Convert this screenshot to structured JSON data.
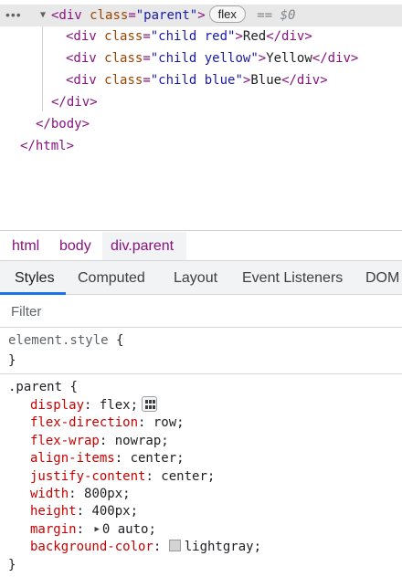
{
  "dom_tree": {
    "ellipsis": "•••",
    "selected": {
      "expand_arrow": "▼",
      "tag_open": "<div",
      "attr_name": "class",
      "attr_value": "\"parent\"",
      "tag_close": ">",
      "badge": "flex",
      "eq_marker": "== $0"
    },
    "children": [
      {
        "tag_open": "<div",
        "attr_name": "class",
        "attr_value": "\"child red\"",
        "tag_close": ">",
        "text": "Red",
        "end_tag": "</div>"
      },
      {
        "tag_open": "<div",
        "attr_name": "class",
        "attr_value": "\"child yellow\"",
        "tag_close": ">",
        "text": "Yellow",
        "end_tag": "</div>"
      },
      {
        "tag_open": "<div",
        "attr_name": "class",
        "attr_value": "\"child blue\"",
        "tag_close": ">",
        "text": "Blue",
        "end_tag": "</div>"
      }
    ],
    "closing": [
      "</div>",
      "</body>",
      "</html>"
    ]
  },
  "breadcrumb": [
    "html",
    "body",
    "div.parent"
  ],
  "tabs": [
    "Styles",
    "Computed",
    "Layout",
    "Event Listeners",
    "DOM"
  ],
  "active_tab": "Styles",
  "filter": {
    "placeholder": "Filter"
  },
  "styles": {
    "element_style": {
      "selector": "element.style",
      "open": "{",
      "close": "}"
    },
    "parent_rule": {
      "selector": ".parent",
      "open": "{",
      "close": "}",
      "declarations": [
        {
          "prop": "display",
          "value": "flex",
          "extra": "flex-editor-icon"
        },
        {
          "prop": "flex-direction",
          "value": "row"
        },
        {
          "prop": "flex-wrap",
          "value": "nowrap"
        },
        {
          "prop": "align-items",
          "value": "center"
        },
        {
          "prop": "justify-content",
          "value": "center"
        },
        {
          "prop": "width",
          "value": "800px"
        },
        {
          "prop": "height",
          "value": "400px"
        },
        {
          "prop": "margin",
          "value": "0 auto",
          "extra": "expand-arrow"
        },
        {
          "prop": "background-color",
          "value": "lightgray",
          "swatch_color": "#d3d3d3"
        }
      ]
    }
  },
  "colors": {
    "tag": "#881280",
    "attr_name": "#994500",
    "attr_value": "#1a1aa6",
    "css_property": "#c80000",
    "active_tab_underline": "#1a73e8",
    "selected_row_bg": "#e8e8e8"
  }
}
